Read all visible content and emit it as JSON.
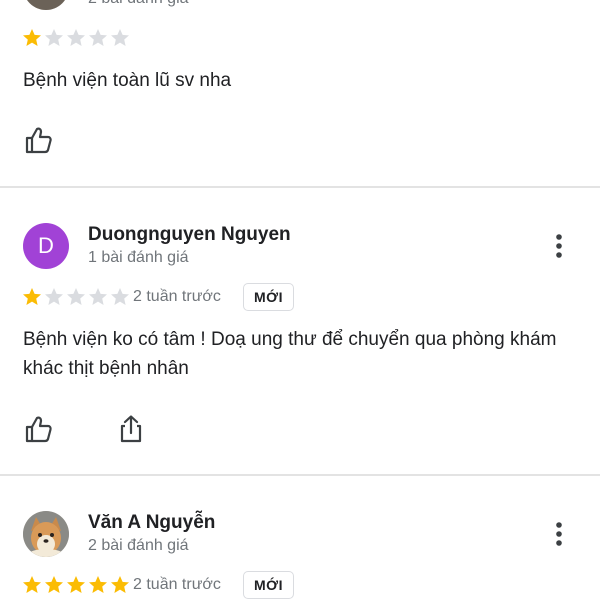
{
  "colors": {
    "star_filled": "#fbbc04",
    "star_empty": "#dadce0",
    "avatar_purple": "#a142d6",
    "divider": "#e3e3e3",
    "secondary_text": "#70757a"
  },
  "reviews": [
    {
      "reviewer_name": "",
      "review_count": "2 bài đánh giá",
      "rating": 1,
      "max_rating": 5,
      "text": "Bệnh viện toàn lũ sv nha",
      "actions": [
        "like-icon"
      ]
    },
    {
      "avatar_letter": "D",
      "reviewer_name": "Duongnguyen Nguyen",
      "review_count": "1 bài đánh giá",
      "rating": 1,
      "max_rating": 5,
      "time": "2 tuần trước",
      "badge": "MỚI",
      "text": "Bệnh viện ko có tâm ! Doạ ung thư để chuyển qua phòng khám khác thịt bệnh nhân",
      "actions": [
        "like-icon",
        "share-icon"
      ],
      "menu_icon": "more-vertical-icon"
    },
    {
      "avatar_icon": "dog-photo-avatar",
      "reviewer_name": "Văn A Nguyễn",
      "review_count": "2 bài đánh giá",
      "rating": 5,
      "max_rating": 5,
      "time": "2 tuần trước",
      "badge": "MỚI",
      "menu_icon": "more-vertical-icon"
    }
  ]
}
